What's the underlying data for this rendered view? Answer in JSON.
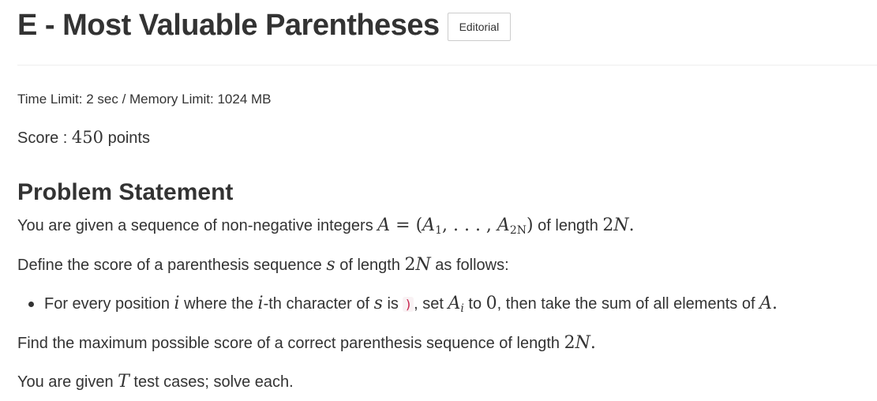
{
  "header": {
    "title": "E - Most Valuable Parentheses",
    "editorial_label": "Editorial"
  },
  "limits": {
    "text": "Time Limit: 2 sec / Memory Limit: 1024 MB"
  },
  "score": {
    "prefix": "Score : ",
    "value": "450",
    "suffix": " points"
  },
  "problem": {
    "heading": "Problem Statement",
    "p1": {
      "t1": "You are given a sequence of non-negative integers ",
      "A": "A",
      "eq": " = (",
      "A1": "A",
      "sub1": "1",
      "dots": ", . . . , ",
      "A2N": "A",
      "sub2N": "2N",
      "close": ")",
      "t2": " of length ",
      "len_num": "2",
      "len_var": "N",
      "end": "."
    },
    "p2": {
      "t1": "Define the score of a parenthesis sequence ",
      "s": "s",
      "t2": " of length ",
      "len_num": "2",
      "len_var": "N",
      "t3": " as follows:"
    },
    "bullet": {
      "t1": "For every position ",
      "i": "i",
      "t2": " where the ",
      "i2": "i",
      "t3": "-th character of ",
      "s": "s",
      "t4": " is ",
      "paren": ")",
      "t5": ", set ",
      "Ai": "A",
      "sub_i": "i",
      "t6": " to ",
      "zero": "0",
      "t7": ", then take the sum of all elements of ",
      "A": "A",
      "end": "."
    },
    "p3": {
      "t1": "Find the maximum possible score of a correct parenthesis sequence of length ",
      "len_num": "2",
      "len_var": "N",
      "end": "."
    },
    "p4": {
      "t1": "You are given ",
      "T": "T",
      "t2": " test cases; solve each."
    }
  }
}
